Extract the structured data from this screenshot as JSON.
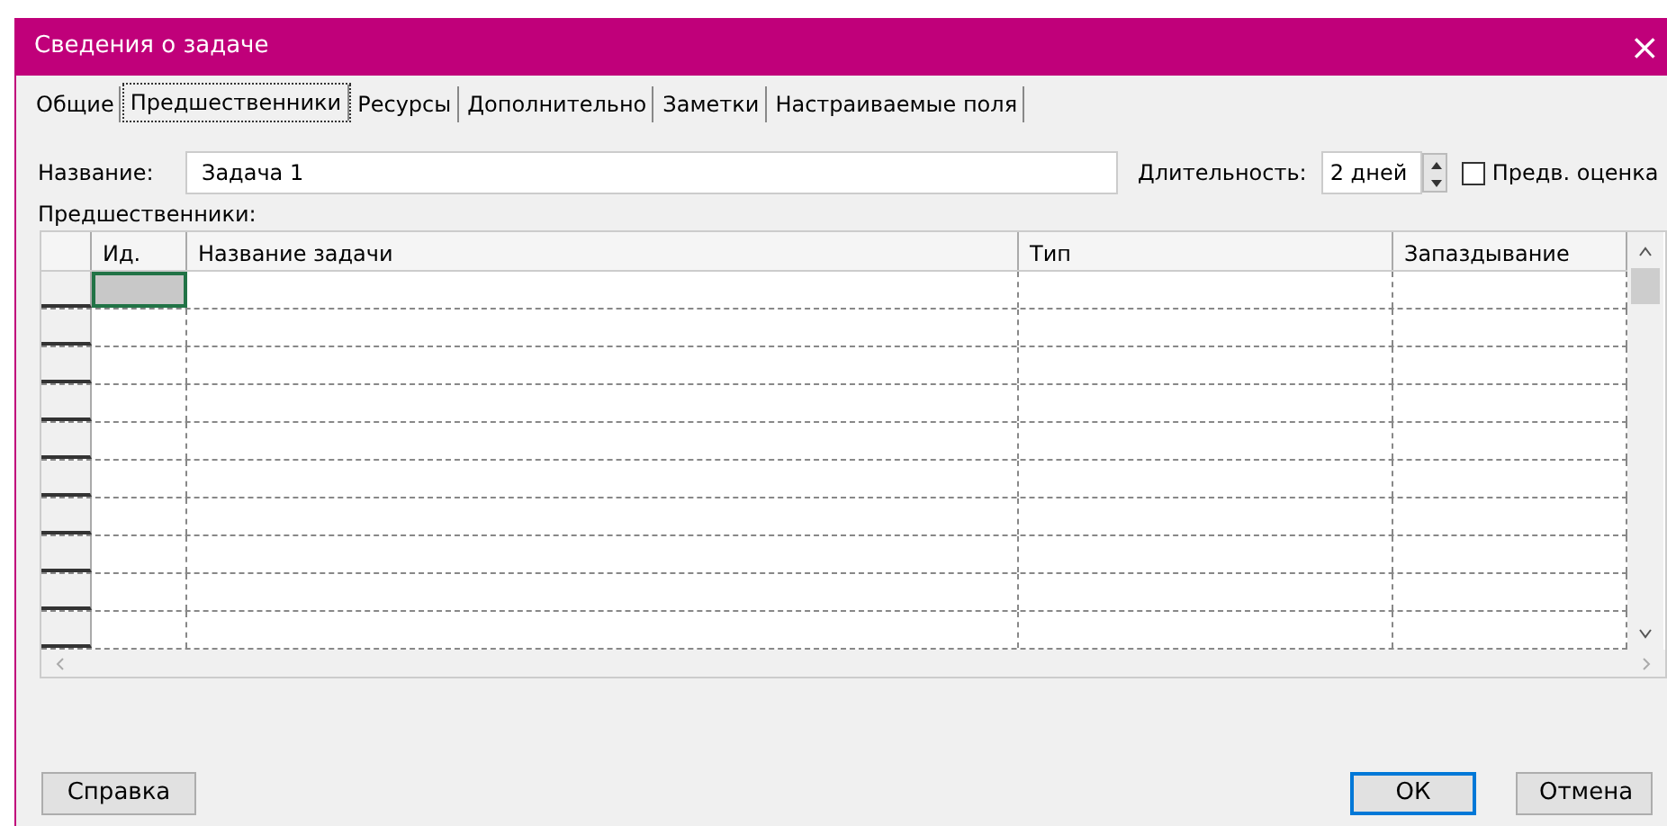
{
  "window": {
    "title": "Сведения о задаче",
    "close": "×"
  },
  "tabs": [
    {
      "label": "Общие",
      "selected": false
    },
    {
      "label": "Предшественники",
      "selected": true
    },
    {
      "label": "Ресурсы",
      "selected": false
    },
    {
      "label": "Дополнительно",
      "selected": false
    },
    {
      "label": "Заметки",
      "selected": false
    },
    {
      "label": "Настраиваемые поля",
      "selected": false
    }
  ],
  "name_field": {
    "label": "Название:",
    "value": "Задача 1"
  },
  "duration_field": {
    "label": "Длительность:",
    "value": "2 дней"
  },
  "estimate_checkbox": {
    "label": "Предв. оценка",
    "checked": false
  },
  "grid": {
    "label": "Предшественники:",
    "columns": [
      "Ид.",
      "Название задачи",
      "Тип",
      "Запаздывание"
    ],
    "rows": [
      {
        "selected": true
      },
      {
        "selected": false
      },
      {
        "selected": false
      },
      {
        "selected": false
      },
      {
        "selected": false
      },
      {
        "selected": false
      },
      {
        "selected": false
      },
      {
        "selected": false
      },
      {
        "selected": false
      },
      {
        "selected": false
      }
    ]
  },
  "help_button": {
    "label": "Справка"
  },
  "buttons": [
    {
      "label": "ОК",
      "default": true
    },
    {
      "label": "Отмена",
      "default": false
    }
  ]
}
